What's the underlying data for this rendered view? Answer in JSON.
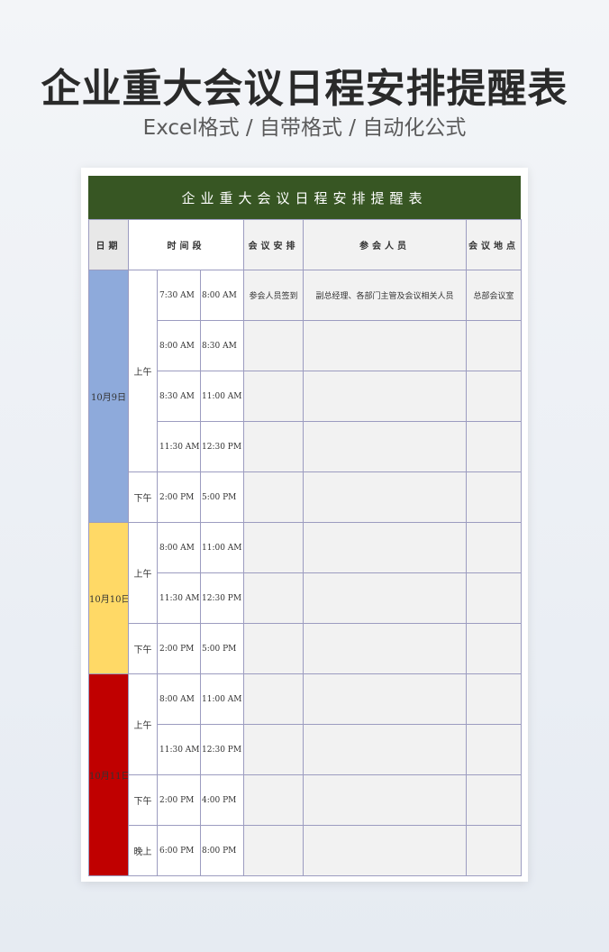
{
  "hero": {
    "title": "企业重大会议日程安排提醒表",
    "subtitle": "Excel格式 / 自带格式 / 自动化公式"
  },
  "table": {
    "title": "企业重大会议日程安排提醒表",
    "headers": {
      "date": "日期",
      "time": "时间段",
      "arrangement": "会议安排",
      "attendees": "参会人员",
      "location": "会议地点"
    },
    "colors": {
      "title_bg": "#375623",
      "day1": "#8eaadb",
      "day2": "#ffd966",
      "day3": "#c00000",
      "grid": "#9c9cc0",
      "cell_bg": "#f2f2f2"
    },
    "days": [
      {
        "date": "10月9日",
        "rows": [
          {
            "period": "上午",
            "start": "7:30 AM",
            "end": "8:00 AM",
            "arrangement": "参会人员签到",
            "attendees": "副总经理、各部门主管及会议相关人员",
            "location": "总部会议室"
          },
          {
            "period": "上午",
            "start": "8:00 AM",
            "end": "8:30 AM",
            "arrangement": "",
            "attendees": "",
            "location": ""
          },
          {
            "period": "上午",
            "start": "8:30 AM",
            "end": "11:00 AM",
            "arrangement": "",
            "attendees": "",
            "location": ""
          },
          {
            "period": "上午",
            "start": "11:30 AM",
            "end": "12:30 PM",
            "arrangement": "",
            "attendees": "",
            "location": ""
          },
          {
            "period": "下午",
            "start": "2:00 PM",
            "end": "5:00 PM",
            "arrangement": "",
            "attendees": "",
            "location": ""
          }
        ]
      },
      {
        "date": "10月10日",
        "rows": [
          {
            "period": "上午",
            "start": "8:00 AM",
            "end": "11:00 AM",
            "arrangement": "",
            "attendees": "",
            "location": ""
          },
          {
            "period": "上午",
            "start": "11:30 AM",
            "end": "12:30 PM",
            "arrangement": "",
            "attendees": "",
            "location": ""
          },
          {
            "period": "下午",
            "start": "2:00 PM",
            "end": "5:00 PM",
            "arrangement": "",
            "attendees": "",
            "location": ""
          }
        ]
      },
      {
        "date": "10月11日",
        "rows": [
          {
            "period": "上午",
            "start": "8:00 AM",
            "end": "11:00 AM",
            "arrangement": "",
            "attendees": "",
            "location": ""
          },
          {
            "period": "上午",
            "start": "11:30 AM",
            "end": "12:30 PM",
            "arrangement": "",
            "attendees": "",
            "location": ""
          },
          {
            "period": "下午",
            "start": "2:00 PM",
            "end": "4:00 PM",
            "arrangement": "",
            "attendees": "",
            "location": ""
          },
          {
            "period": "晚上",
            "start": "6:00 PM",
            "end": "8:00 PM",
            "arrangement": "",
            "attendees": "",
            "location": ""
          }
        ]
      }
    ]
  }
}
